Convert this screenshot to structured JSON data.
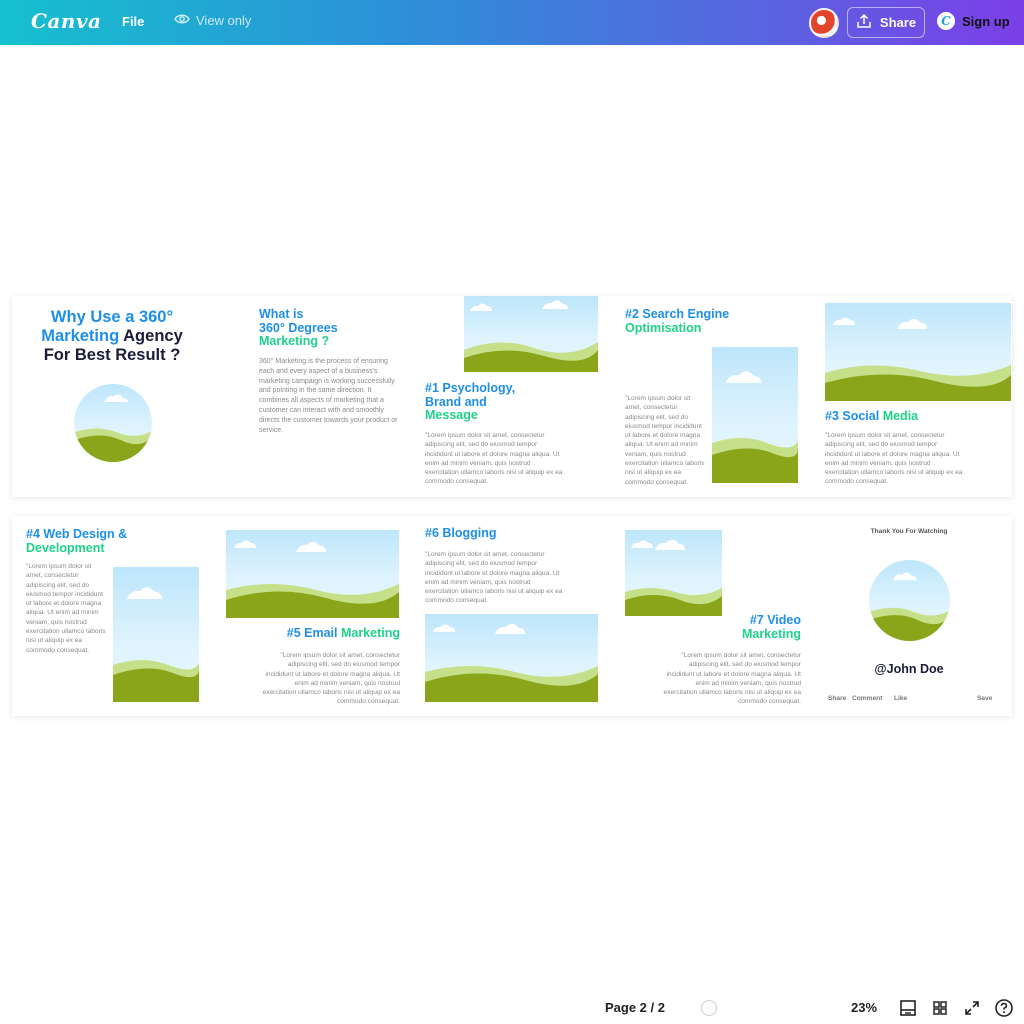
{
  "app": {
    "logo": "Canva",
    "file_label": "File",
    "view_only_label": "View only",
    "share_label": "Share",
    "signup_label": "Sign up",
    "signup_badge": "C"
  },
  "colors": {
    "accent_blue": "#1e8fe8",
    "accent_green": "#1ed28a",
    "dark_text": "#1c1c3a",
    "gradient_start": "#16c0cf",
    "gradient_end": "#7b3fe8"
  },
  "slide1": {
    "title_line1": "Why Use a 360°",
    "title_line2_a": "Marketing",
    "title_line2_b": " Agency",
    "title_line3": "For Best Result ?",
    "whatis_line1": "What is",
    "whatis_line2": "360° Degrees",
    "whatis_line3": "Marketing ?",
    "whatis_para": "360° Marketing is the process of ensuring each and every aspect of a business's marketing campaign is working successfully and pointing in the same direction. It combines all aspects of marketing that a customer can interact with and smoothly directs the customer towards your product or service.",
    "p1_line1": "#1 Psychology,",
    "p1_line2": "Brand and",
    "p1_line3": "Message",
    "p1_para": "\"Lorem ipsum dolor sit amet, consectetur adipiscing elit, sed do eiusmod tempor incididunt ut labore et dolore magna aliqua. Ut enim ad minim veniam, quis nostrud exercitation ullamco laboris nisi ut aliquip ex ea commodo consequat.",
    "p2_line1": "#2 Search Engine",
    "p2_line2": "Optimisation",
    "p2_para": "\"Lorem ipsum dolor sit amet, consectetur adipiscing elit, sed do eiusmod tempor incididunt ut labore et dolore magna aliqua. Ut enim ad minim veniam, quis nostrud exercitation ullamco laboris nisi ut aliquip ex ea commodo consequat.",
    "p3_a": "#3 Social ",
    "p3_b": "Media",
    "p3_para": "\"Lorem ipsum dolor sit amet, consectetur adipiscing elit, sed do eiusmod tempor incididunt ut labore et dolore magna aliqua. Ut enim ad minim veniam, quis nostrud exercitation ullamco laboris nisi ut aliquip ex ea commodo consequat."
  },
  "slide2": {
    "p4_line1": "#4 Web Design &",
    "p4_line2": "Development",
    "p4_para": "\"Lorem ipsum dolor sit amet, consectetur adipiscing elit, sed do eiusmod tempor incididunt ut labore et dolore magna aliqua. Ut enim ad minim veniam, quis nostrud exercitation ullamco laboris nisi ut aliquip ex ea commodo consequat.",
    "p5_a": "#5 Email ",
    "p5_b": "Marketing",
    "p5_para": "\"Lorem ipsum dolor sit amet, consectetur adipiscing elit, sed do eiusmod tempor incididunt ut labore et dolore magna aliqua. Ut enim ad minim veniam, quis nostrud exercitation ullamco laboris nisi ut aliquip ex ea commodo consequat.",
    "p6_a": "#6 ",
    "p6_b": "Blogging",
    "p6_para": "\"Lorem ipsum dolor sit amet, consectetur adipiscing elit, sed do eiusmod tempor incididunt ut labore et dolore magna aliqua. Ut enim ad minim veniam, quis nostrud exercitation ullamco laboris nisi ut aliquip ex ea commodo consequat.",
    "p7_line1": "#7 Video",
    "p7_line2": "Marketing",
    "p7_para": "\"Lorem ipsum dolor sit amet, consectetur adipiscing elit, sed do eiusmod tempor incididunt ut labore et dolore magna aliqua. Ut enim ad minim veniam, quis nostrud exercitation ullamco laboris nisi ut aliquip ex ea commodo consequat.",
    "thanks": "Thank You For Watching",
    "handle": "@John Doe",
    "action_share": "Share",
    "action_comment": "Comment",
    "action_like": "Like",
    "action_save": "Save"
  },
  "footer": {
    "page_indicator": "Page 2 / 2",
    "zoom": "23%"
  },
  "icons": {
    "view_only": "eye-icon",
    "share": "upload-icon",
    "layout": "page-layout-icon",
    "grid": "grid-view-icon",
    "fullscreen": "fullscreen-icon",
    "help": "help-icon"
  }
}
